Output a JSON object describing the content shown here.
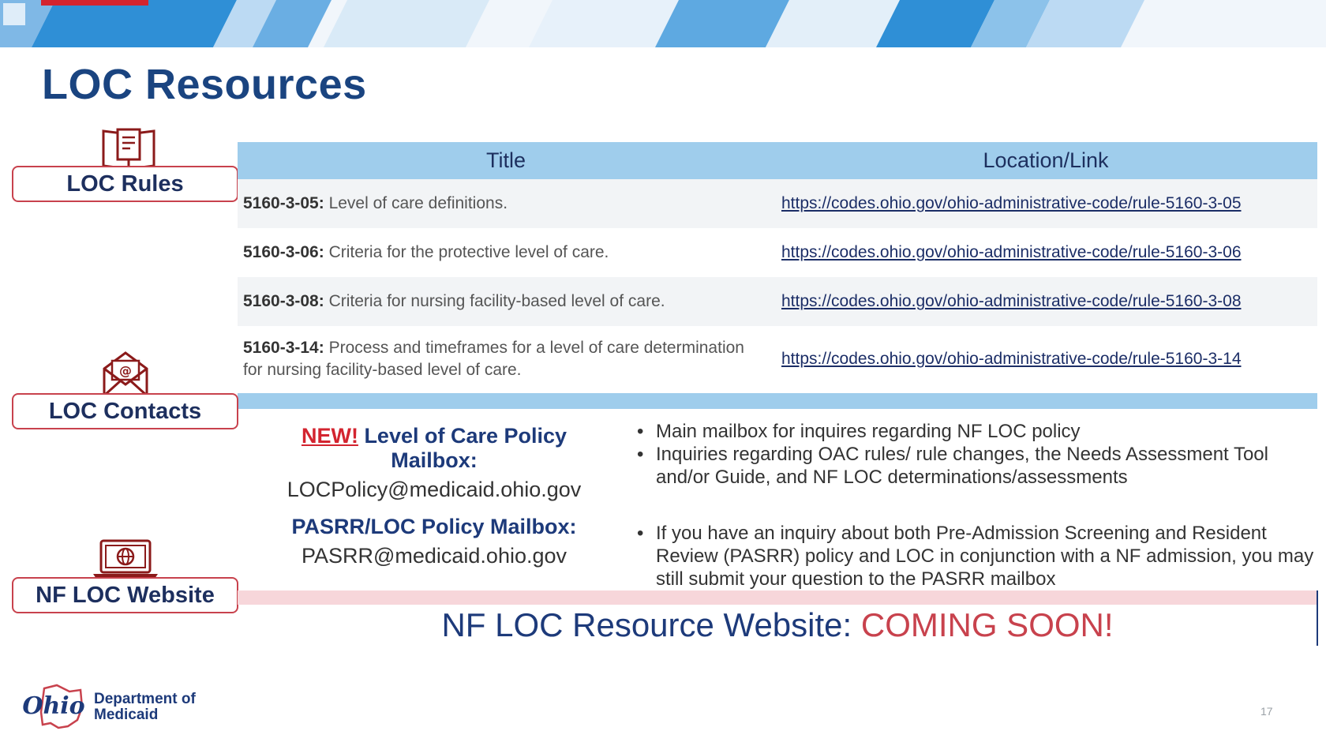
{
  "page": {
    "title": "LOC Resources",
    "page_number": "17"
  },
  "sections": {
    "rules": "LOC Rules",
    "contacts": "LOC Contacts",
    "website": "NF LOC Website"
  },
  "table": {
    "headers": {
      "title": "Title",
      "link": "Location/Link"
    },
    "rows": [
      {
        "code": "5160-3-05:",
        "desc": " Level of care definitions.",
        "link": "https://codes.ohio.gov/ohio-administrative-code/rule-5160-3-05"
      },
      {
        "code": "5160-3-06:",
        "desc": " Criteria for the protective level of care.",
        "link": "https://codes.ohio.gov/ohio-administrative-code/rule-5160-3-06"
      },
      {
        "code": "5160-3-08:",
        "desc": " Criteria for nursing facility-based level of care.",
        "link": "https://codes.ohio.gov/ohio-administrative-code/rule-5160-3-08"
      },
      {
        "code": "5160-3-14:",
        "desc": " Process and timeframes for a level of care determination for nursing facility-based level of care.",
        "link": "https://codes.ohio.gov/ohio-administrative-code/rule-5160-3-14"
      }
    ]
  },
  "contacts": {
    "loc_mailbox": {
      "new_tag": "NEW!",
      "heading": " Level of Care Policy Mailbox:",
      "email": "LOCPolicy@medicaid.ohio.gov",
      "bullets": [
        "Main mailbox for inquires regarding NF LOC policy",
        "Inquiries regarding OAC rules/ rule changes, the Needs Assessment Tool and/or Guide, and NF LOC determinations/assessments"
      ]
    },
    "pasrr_mailbox": {
      "heading": "PASRR/LOC Policy Mailbox:",
      "email": "PASRR@medicaid.ohio.gov",
      "bullets": [
        "If you have an inquiry about both Pre-Admission Screening and Resident Review (PASRR) policy and LOC in conjunction with a NF admission, you may still submit your question to the PASRR mailbox"
      ]
    }
  },
  "website": {
    "label": "NF LOC Resource Website: ",
    "status": "COMING SOON!"
  },
  "footer": {
    "logo_text": "Ohio",
    "dept_line1": "Department of",
    "dept_line2": "Medicaid"
  },
  "colors": {
    "navy": "#1a4480",
    "accent_red": "#c8424d",
    "table_header": "#9fcdec"
  },
  "icons": [
    "book-icon",
    "envelope-at-icon",
    "laptop-globe-icon"
  ]
}
